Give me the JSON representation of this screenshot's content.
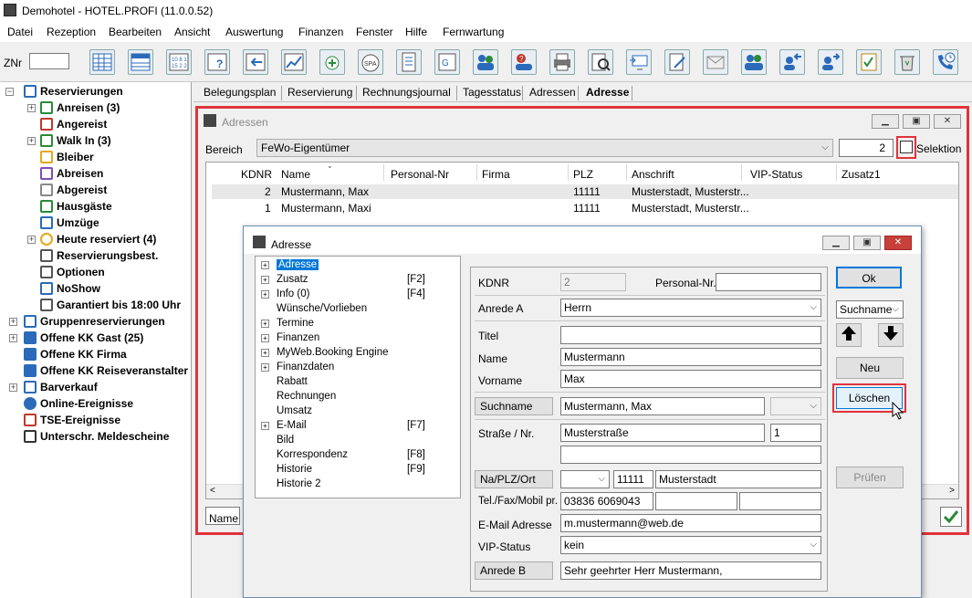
{
  "app": {
    "title": "Demohotel - HOTEL.PROFI (11.0.0.52)"
  },
  "menu": [
    "Datei",
    "Rezeption",
    "Bearbeiten",
    "Ansicht",
    "Auswertung",
    "Finanzen",
    "Fenster",
    "Hilfe",
    "Fernwartung"
  ],
  "toolbar": {
    "znr_label": "ZNr",
    "spa_label": "SPA"
  },
  "tree": [
    {
      "label": "Reservierungen",
      "color": "#2a6ab8"
    },
    {
      "label": "Anreisen (3)",
      "color": "#2a8a3a"
    },
    {
      "label": "Angereist",
      "color": "#c0392b"
    },
    {
      "label": "Walk In (3)",
      "color": "#2a8a3a"
    },
    {
      "label": "Bleiber",
      "color": "#e6a817"
    },
    {
      "label": "Abreisen",
      "color": "#7b4fb8"
    },
    {
      "label": "Abgereist",
      "color": "#888888"
    },
    {
      "label": "Hausgäste",
      "color": "#2a8a3a"
    },
    {
      "label": "Umzüge",
      "color": "#2a6ab8"
    },
    {
      "label": "Heute reserviert (4)",
      "color": "#e6a817"
    },
    {
      "label": "Reservierungsbest.",
      "color": "#555555"
    },
    {
      "label": "Optionen",
      "color": "#555555"
    },
    {
      "label": "NoShow",
      "color": "#2a6ab8"
    },
    {
      "label": "Garantiert bis 18:00 Uhr",
      "color": "#555555"
    },
    {
      "label": "Gruppenreservierungen",
      "color": "#2a6ab8"
    },
    {
      "label": "Offene KK Gast (25)",
      "color": "#2a6ab8"
    },
    {
      "label": "Offene KK Firma",
      "color": "#2a6ab8"
    },
    {
      "label": "Offene KK Reiseveranstalter",
      "color": "#2a6ab8"
    },
    {
      "label": "Barverkauf",
      "color": "#2a6ab8"
    },
    {
      "label": "Online-Ereignisse",
      "color": "#2a6ab8"
    },
    {
      "label": "TSE-Ereignisse",
      "color": "#c0392b"
    },
    {
      "label": "Unterschr. Meldescheine",
      "color": "#333333"
    }
  ],
  "tabs": [
    "Belegungsplan",
    "Reservierung",
    "Rechnungsjournal",
    "Tagesstatus",
    "Adressen",
    "Adresse"
  ],
  "adressen": {
    "title": "Adressen",
    "bereich_label": "Bereich",
    "bereich_value": "FeWo-Eigentümer",
    "count": "2",
    "selektion_label": "Selektion",
    "columns": [
      "KDNR",
      "Name",
      "Personal-Nr",
      "Firma",
      "PLZ",
      "Anschrift",
      "VIP-Status",
      "Zusatz1"
    ],
    "rows": [
      [
        "2",
        "Mustermann, Max",
        "",
        "",
        "11111",
        "Musterstadt, Musterstr...",
        "",
        ""
      ],
      [
        "1",
        "Mustermann, Maxi",
        "",
        "",
        "11111",
        "Musterstadt, Musterstr...",
        "",
        ""
      ]
    ],
    "name_filter_label": "Name"
  },
  "adresse": {
    "title": "Adresse",
    "nav": [
      {
        "label": "Adresse",
        "key": "",
        "exp": true
      },
      {
        "label": "Zusatz",
        "key": "[F2]",
        "exp": true
      },
      {
        "label": "Info (0)",
        "key": "[F4]",
        "exp": true
      },
      {
        "label": "Wünsche/Vorlieben",
        "key": "",
        "exp": false
      },
      {
        "label": "Termine",
        "key": "",
        "exp": true
      },
      {
        "label": "Finanzen",
        "key": "",
        "exp": true
      },
      {
        "label": "MyWeb.Booking Engine",
        "key": "",
        "exp": true
      },
      {
        "label": "Finanzdaten",
        "key": "",
        "exp": true
      },
      {
        "label": "Rabatt",
        "key": "",
        "exp": false
      },
      {
        "label": "Rechnungen",
        "key": "",
        "exp": false
      },
      {
        "label": "Umsatz",
        "key": "",
        "exp": false
      },
      {
        "label": "E-Mail",
        "key": "[F7]",
        "exp": true
      },
      {
        "label": "Bild",
        "key": "",
        "exp": false
      },
      {
        "label": "Korrespondenz",
        "key": "[F8]",
        "exp": false
      },
      {
        "label": "Historie",
        "key": "[F9]",
        "exp": false
      },
      {
        "label": "Historie 2",
        "key": "",
        "exp": false
      }
    ],
    "form": {
      "kdnr_label": "KDNR",
      "kdnr_value": "2",
      "personal_label": "Personal-Nr.",
      "personal_value": "",
      "anrede_a_label": "Anrede A",
      "anrede_a_value": "Herrn",
      "titel_label": "Titel",
      "titel_value": "",
      "name_label": "Name",
      "name_value": "Mustermann",
      "vorname_label": "Vorname",
      "vorname_value": "Max",
      "suchname_label": "Suchname",
      "suchname_value": "Mustermann, Max",
      "strasse_label": "Straße / Nr.",
      "strasse_value": "Musterstraße",
      "hausnr_value": "1",
      "zusatz_value": "",
      "naplzort_label": "Na/PLZ/Ort",
      "nation_value": "",
      "plz_value": "11111",
      "ort_value": "Musterstadt",
      "tel_label": "Tel./Fax/Mobil pr.",
      "tel_value": "03836 6069043",
      "fax_value": "",
      "mobil_value": "",
      "email_label": "E-Mail Adresse",
      "email_value": "m.mustermann@web.de",
      "vip_label": "VIP-Status",
      "vip_value": "kein",
      "anrede_b_label": "Anrede B",
      "anrede_b_value": "Sehr geehrter Herr Mustermann,"
    },
    "buttons": {
      "ok": "Ok",
      "sort_value": "Suchname",
      "neu": "Neu",
      "loeschen": "Löschen",
      "pruefen": "Prüfen"
    }
  },
  "colors": {
    "highlight": "#e0333b",
    "accent": "#0078d7"
  }
}
